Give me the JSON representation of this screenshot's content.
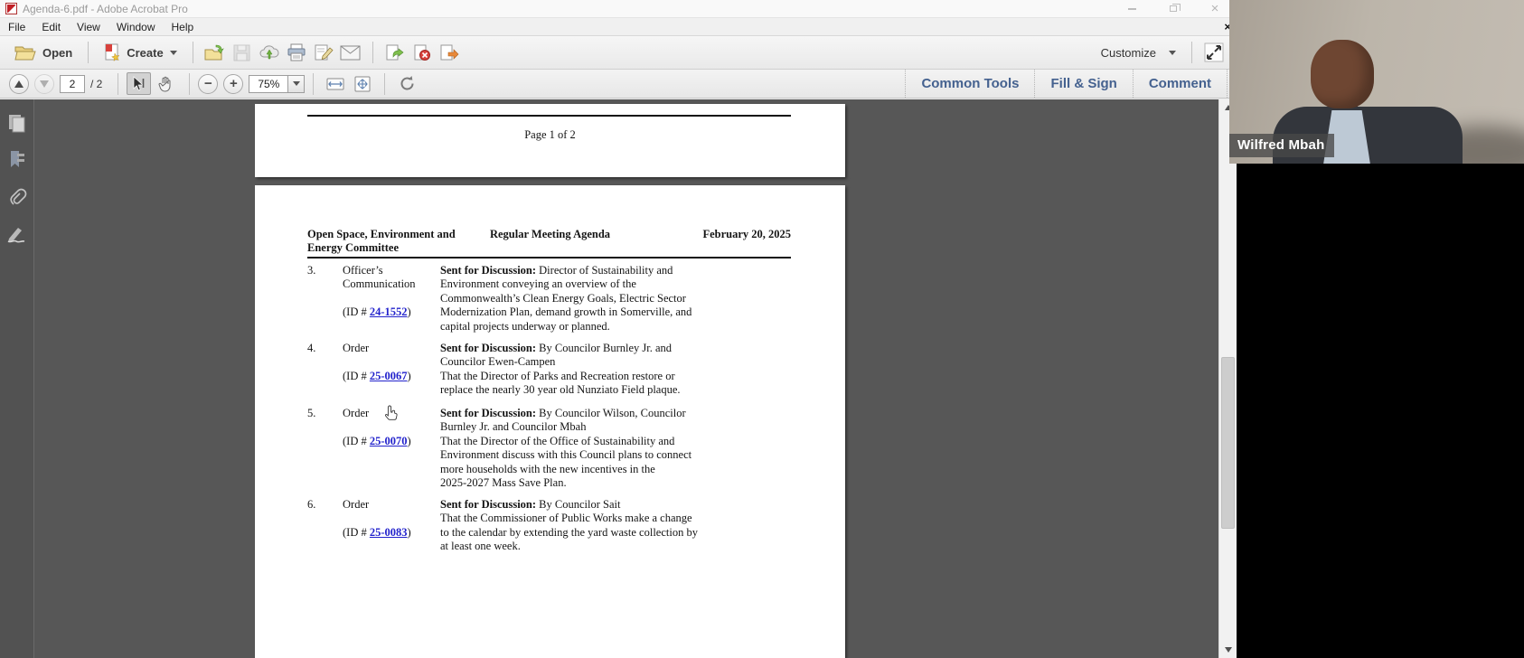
{
  "window": {
    "title": "Agenda-6.pdf - Adobe Acrobat Pro"
  },
  "menubar": {
    "items": [
      "File",
      "Edit",
      "View",
      "Window",
      "Help"
    ],
    "close_x": "×"
  },
  "toolbar": {
    "open_label": "Open",
    "create_label": "Create",
    "customize_label": "Customize",
    "quick_tools": [
      "open-file-icon",
      "save-icon",
      "cloud-upload-icon",
      "print-icon",
      "sign-document-icon",
      "email-icon",
      "export-page-icon",
      "delete-page-icon",
      "extract-page-icon"
    ]
  },
  "nav": {
    "page_current": "2",
    "page_total": "/ 2",
    "zoom_level": "75%",
    "minus": "−",
    "plus": "+"
  },
  "panels": {
    "tabs": [
      "Common Tools",
      "Fill & Sign",
      "Comment"
    ]
  },
  "document": {
    "page1": {
      "footer": "Page 1 of 2"
    },
    "page2": {
      "header": {
        "committee": [
          "Open Space, Environment and",
          "Energy Committee"
        ],
        "center": "Regular Meeting Agenda",
        "date": "February 20, 2025"
      },
      "items": [
        {
          "num": "3.",
          "type": [
            "Officer’s",
            "Communication"
          ],
          "id_open": "(ID # ",
          "id_link": "24-1552",
          "id_close": ")",
          "desc_bold": "Sent for Discussion:",
          "desc_rest": [
            " Director of Sustainability and",
            "Environment conveying an overview of the",
            "Commonwealth’s Clean Energy Goals, Electric Sector",
            "Modernization Plan, demand growth in Somerville, and",
            "capital projects underway or planned."
          ]
        },
        {
          "num": "4.",
          "type": [
            "Order"
          ],
          "id_open": "(ID # ",
          "id_link": "25-0067",
          "id_close": ")",
          "desc_bold": "Sent for Discussion:",
          "desc_rest": [
            " By Councilor Burnley Jr. and",
            "Councilor Ewen-Campen",
            "That the Director of Parks and Recreation restore or",
            "replace the nearly 30 year old Nunziato Field plaque."
          ]
        },
        {
          "num": "5.",
          "type": [
            "Order"
          ],
          "id_open": "(ID # ",
          "id_link": "25-0070",
          "id_close": ")",
          "desc_bold": "Sent for Discussion:",
          "desc_rest": [
            " By Councilor Wilson, Councilor",
            "Burnley Jr. and Councilor Mbah",
            "That the Director of the Office of Sustainability and",
            "Environment discuss with this Council plans to connect",
            "more households with the new incentives in the",
            "2025-2027 Mass Save Plan."
          ]
        },
        {
          "num": "6.",
          "type": [
            "Order"
          ],
          "id_open": "(ID # ",
          "id_link": "25-0083",
          "id_close": ")",
          "desc_bold": "Sent for Discussion:",
          "desc_rest": [
            " By Councilor Sait",
            "That the Commissioner of Public Works make a change",
            "to the calendar by extending the yard waste collection by",
            "at least one week."
          ]
        }
      ]
    }
  },
  "video": {
    "participant_name": "Wilfred Mbah"
  },
  "colors": {
    "link_blue": "#2323cc",
    "panel_tab_blue": "#44618f",
    "canvas_gray": "#575757",
    "sidebar_gray": "#525252",
    "acrobat_red": "#c11f25"
  }
}
